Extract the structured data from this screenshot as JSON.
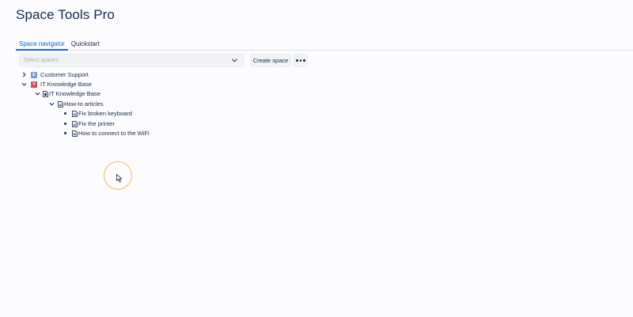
{
  "app": {
    "title": "Space Tools Pro"
  },
  "tabs": [
    {
      "label": "Space navigator",
      "active": true
    },
    {
      "label": "Quickstart",
      "active": false
    }
  ],
  "space_select": {
    "placeholder": "Select spaces"
  },
  "actions": {
    "create_space_label": "Create space",
    "more_icon": "more-horizontal-icon"
  },
  "tree": {
    "spaces": [
      {
        "label": "Customer Support",
        "expanded": false,
        "icon": "customer-support-space-icon",
        "icon_letter": "E",
        "icon_color": "#7a9cc6"
      },
      {
        "label": "IT Knowledge Base",
        "expanded": true,
        "icon": "it-knowledge-base-space-icon",
        "icon_letter": "Y",
        "icon_color": "#d1495b",
        "home_page": {
          "label": "IT Knowledge Base",
          "expanded": true,
          "folder": {
            "label": "How-to articles",
            "expanded": true,
            "pages": [
              {
                "label": "Fix broken keyboard"
              },
              {
                "label": "Fix the printer"
              },
              {
                "label": "How to connect to the WiFi"
              }
            ]
          }
        }
      }
    ]
  },
  "colors": {
    "accent": "#0c66e4",
    "text": "#172b4d",
    "cursor_highlight": "#f0c050"
  }
}
